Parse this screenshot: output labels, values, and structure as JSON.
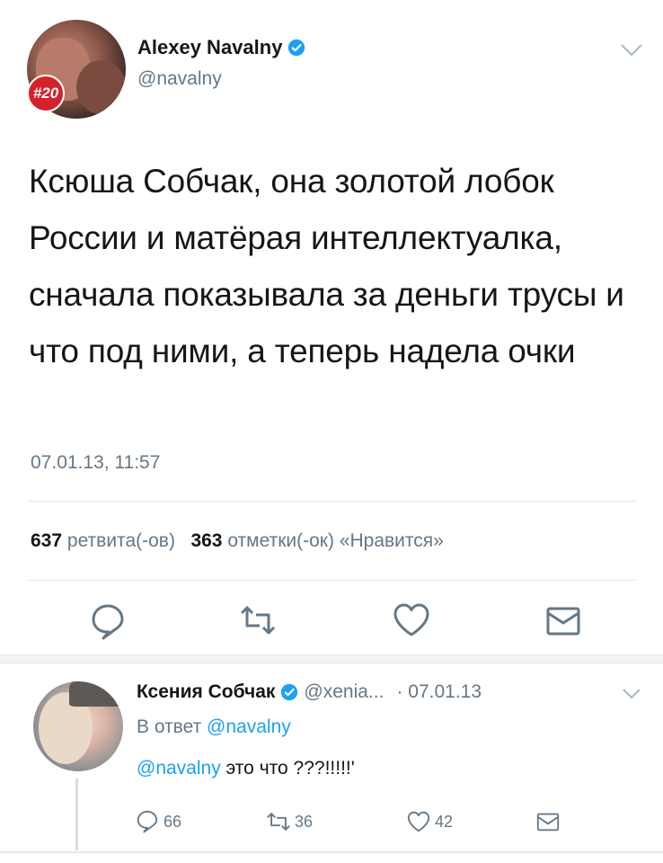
{
  "colors": {
    "accent": "#1da1f2",
    "secondary_text": "#657786",
    "badge": "#d6212c"
  },
  "main_tweet": {
    "author_name": "Alexey Navalny",
    "handle": "@navalny",
    "avatar_badge": "#20",
    "text": "Ксюша Собчак, она золотой лобок России и матёрая интеллектуалка, сначала показывала за деньги трусы и что под ними, а теперь надела очки",
    "timestamp": "07.01.13, 11:57",
    "retweet_count": "637",
    "retweet_label": "ретвита(-ов)",
    "like_count": "363",
    "like_label": "отметки(-ок) «Нравится»"
  },
  "reply": {
    "author_name": "Ксения Собчак",
    "handle": "@xenia...",
    "date": "· 07.01.13",
    "reply_to_prefix": "В ответ",
    "reply_to_handle": "@navalny",
    "mention": "@navalny",
    "text": "это что ???!!!!!'",
    "reply_count": "66",
    "retweet_count": "36",
    "like_count": "42"
  }
}
